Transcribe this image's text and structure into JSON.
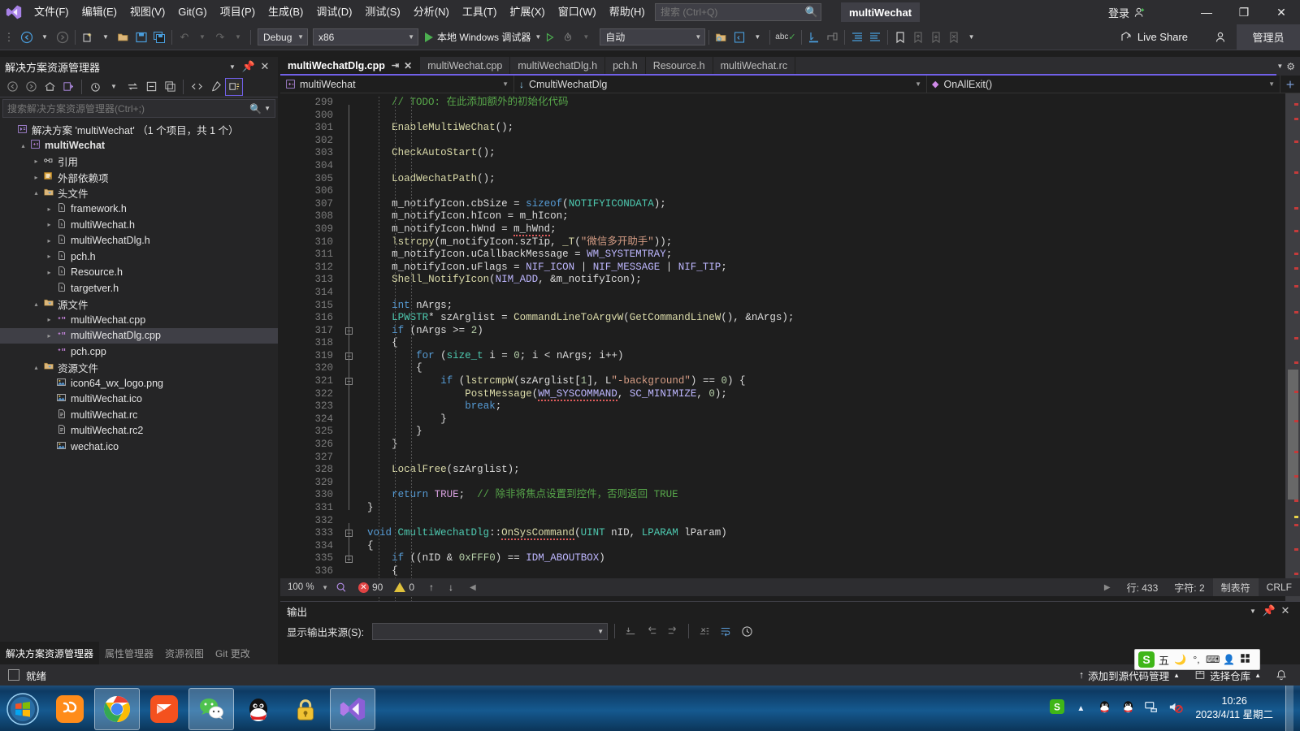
{
  "titlebar": {
    "menus": [
      "文件(F)",
      "编辑(E)",
      "视图(V)",
      "Git(G)",
      "项目(P)",
      "生成(B)",
      "调试(D)",
      "测试(S)",
      "分析(N)",
      "工具(T)",
      "扩展(X)",
      "窗口(W)",
      "帮助(H)"
    ],
    "search_placeholder": "搜索 (Ctrl+Q)",
    "project_badge": "multiWechat",
    "signin": "登录",
    "minimize": "—",
    "restore": "❐",
    "close": "✕"
  },
  "toolbar": {
    "config": "Debug",
    "platform": "x86",
    "run_target": "本地 Windows 调试器",
    "auto": "自动",
    "live_share": "Live Share",
    "admin": "管理员"
  },
  "solution_explorer": {
    "title": "解决方案资源管理器",
    "search_placeholder": "搜索解决方案资源管理器(Ctrl+;)",
    "tree": [
      {
        "indent": 0,
        "arrow": "",
        "icon": "solution-icon",
        "label": "解决方案 'multiWechat' （1 个项目，共 1 个）",
        "bold": false,
        "selected": false
      },
      {
        "indent": 1,
        "arrow": "▴",
        "icon": "cpp-project-icon",
        "label": "multiWechat",
        "bold": true,
        "selected": false
      },
      {
        "indent": 2,
        "arrow": "▸",
        "icon": "references-icon",
        "label": "引用",
        "bold": false,
        "selected": false
      },
      {
        "indent": 2,
        "arrow": "▸",
        "icon": "external-deps-icon",
        "label": "外部依赖项",
        "bold": false,
        "selected": false
      },
      {
        "indent": 2,
        "arrow": "▴",
        "icon": "folder-icon",
        "label": "头文件",
        "bold": false,
        "selected": false
      },
      {
        "indent": 3,
        "arrow": "▸",
        "icon": "header-file-icon",
        "label": "framework.h",
        "bold": false,
        "selected": false
      },
      {
        "indent": 3,
        "arrow": "▸",
        "icon": "header-file-icon",
        "label": "multiWechat.h",
        "bold": false,
        "selected": false
      },
      {
        "indent": 3,
        "arrow": "▸",
        "icon": "header-file-icon",
        "label": "multiWechatDlg.h",
        "bold": false,
        "selected": false
      },
      {
        "indent": 3,
        "arrow": "▸",
        "icon": "header-file-icon",
        "label": "pch.h",
        "bold": false,
        "selected": false
      },
      {
        "indent": 3,
        "arrow": "▸",
        "icon": "header-file-icon",
        "label": "Resource.h",
        "bold": false,
        "selected": false
      },
      {
        "indent": 3,
        "arrow": "",
        "icon": "header-file-icon",
        "label": "targetver.h",
        "bold": false,
        "selected": false
      },
      {
        "indent": 2,
        "arrow": "▴",
        "icon": "folder-icon",
        "label": "源文件",
        "bold": false,
        "selected": false
      },
      {
        "indent": 3,
        "arrow": "▸",
        "icon": "cpp-file-icon",
        "label": "multiWechat.cpp",
        "bold": false,
        "selected": false
      },
      {
        "indent": 3,
        "arrow": "▸",
        "icon": "cpp-file-icon",
        "label": "multiWechatDlg.cpp",
        "bold": false,
        "selected": true
      },
      {
        "indent": 3,
        "arrow": "",
        "icon": "cpp-file-icon",
        "label": "pch.cpp",
        "bold": false,
        "selected": false
      },
      {
        "indent": 2,
        "arrow": "▴",
        "icon": "folder-icon",
        "label": "资源文件",
        "bold": false,
        "selected": false
      },
      {
        "indent": 3,
        "arrow": "",
        "icon": "image-file-icon",
        "label": "icon64_wx_logo.png",
        "bold": false,
        "selected": false
      },
      {
        "indent": 3,
        "arrow": "",
        "icon": "image-file-icon",
        "label": "multiWechat.ico",
        "bold": false,
        "selected": false
      },
      {
        "indent": 3,
        "arrow": "",
        "icon": "rc-file-icon",
        "label": "multiWechat.rc",
        "bold": false,
        "selected": false
      },
      {
        "indent": 3,
        "arrow": "",
        "icon": "rc-file-icon",
        "label": "multiWechat.rc2",
        "bold": false,
        "selected": false
      },
      {
        "indent": 3,
        "arrow": "",
        "icon": "image-file-icon",
        "label": "wechat.ico",
        "bold": false,
        "selected": false
      }
    ],
    "bottom_tabs": [
      {
        "label": "解决方案资源管理器",
        "active": true
      },
      {
        "label": "属性管理器",
        "active": false
      },
      {
        "label": "资源视图",
        "active": false
      },
      {
        "label": "Git 更改",
        "active": false
      }
    ]
  },
  "editor": {
    "tabs": [
      {
        "label": "multiWechatDlg.cpp",
        "active": true
      },
      {
        "label": "multiWechat.cpp",
        "active": false
      },
      {
        "label": "multiWechatDlg.h",
        "active": false
      },
      {
        "label": "pch.h",
        "active": false
      },
      {
        "label": "Resource.h",
        "active": false
      },
      {
        "label": "multiWechat.rc",
        "active": false
      }
    ],
    "nav": {
      "project": "multiWechat",
      "class": "CmultiWechatDlg",
      "member": "OnAllExit()"
    },
    "first_line": 299,
    "code_lines": [
      "    // TODO: 在此添加额外的初始化代码",
      "",
      "    EnableMultiWeChat();",
      "",
      "    CheckAutoStart();",
      "",
      "    LoadWechatPath();",
      "",
      "    m_notifyIcon.cbSize = sizeof(NOTIFYICONDATA);",
      "    m_notifyIcon.hIcon = m_hIcon;",
      "    m_notifyIcon.hWnd = m_hWnd;",
      "    lstrcpy(m_notifyIcon.szTip, _T(\"微信多开助手\"));",
      "    m_notifyIcon.uCallbackMessage = WM_SYSTEMTRAY;",
      "    m_notifyIcon.uFlags = NIF_ICON | NIF_MESSAGE | NIF_TIP;",
      "    Shell_NotifyIcon(NIM_ADD, &m_notifyIcon);",
      "",
      "    int nArgs;",
      "    LPWSTR* szArglist = CommandLineToArgvW(GetCommandLineW(), &nArgs);",
      "    if (nArgs >= 2)",
      "    {",
      "        for (size_t i = 0; i < nArgs; i++)",
      "        {",
      "            if (lstrcmpW(szArglist[1], L\"-background\") == 0) {",
      "                PostMessage(WM_SYSCOMMAND, SC_MINIMIZE, 0);",
      "                break;",
      "            }",
      "        }",
      "    }",
      "",
      "    LocalFree(szArglist);",
      "",
      "    return TRUE;  // 除非将焦点设置到控件，否则返回 TRUE",
      "}",
      "",
      "void CmultiWechatDlg::OnSysCommand(UINT nID, LPARAM lParam)",
      "{",
      "    if ((nID & 0xFFF0) == IDM_ABOUTBOX)",
      "    {"
    ],
    "status": {
      "zoom": "100 %",
      "errors": "90",
      "warnings": "0",
      "line_label": "行: 433",
      "col_label": "字符: 2",
      "tabs_label": "制表符",
      "eol": "CRLF"
    }
  },
  "output": {
    "title": "输出",
    "source_label": "显示输出来源(S):",
    "source_value": ""
  },
  "vs_status": {
    "ready": "就绪",
    "source_control": "添加到源代码管理",
    "repo": "选择仓库"
  },
  "ime": {
    "mode": "五",
    "logo": "S"
  },
  "taskbar": {
    "apps": [
      {
        "name": "start-button",
        "running": false
      },
      {
        "name": "uc-browser-icon",
        "running": false
      },
      {
        "name": "chrome-icon",
        "running": true
      },
      {
        "name": "foxmail-icon",
        "running": false
      },
      {
        "name": "wechat-icon",
        "running": true
      },
      {
        "name": "qq-icon",
        "running": false
      },
      {
        "name": "lock-icon",
        "running": false
      },
      {
        "name": "visual-studio-icon",
        "running": true
      }
    ],
    "clock_time": "10:26",
    "clock_date": "2023/4/11 星期二"
  }
}
